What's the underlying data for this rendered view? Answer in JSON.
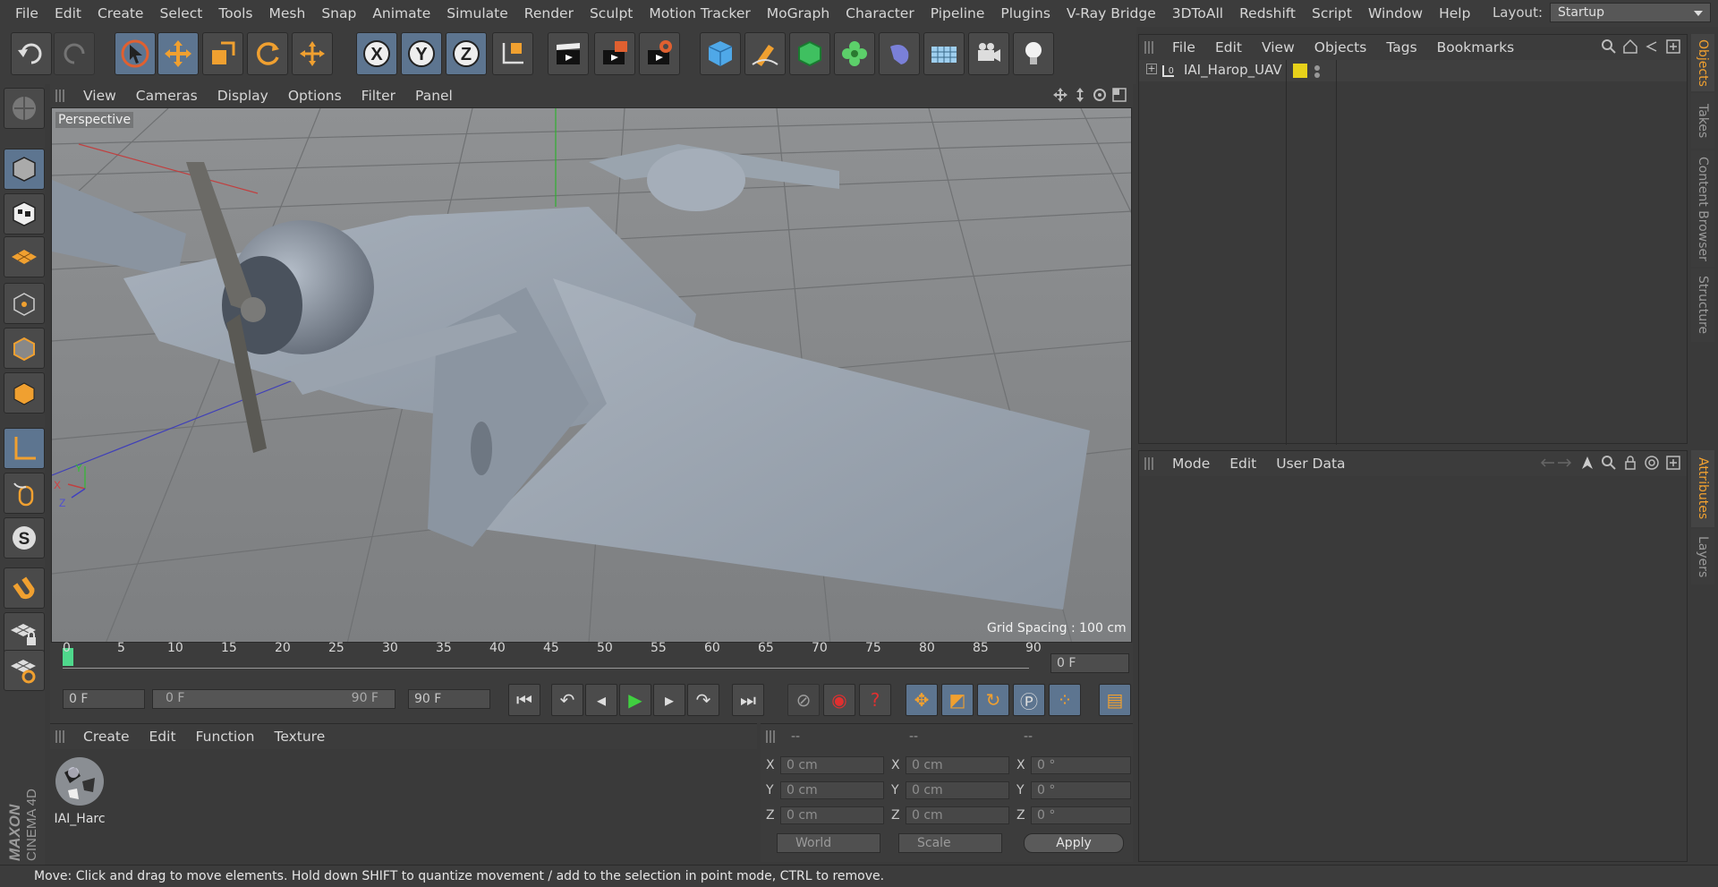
{
  "menubar": {
    "items": [
      "File",
      "Edit",
      "Create",
      "Select",
      "Tools",
      "Mesh",
      "Snap",
      "Animate",
      "Simulate",
      "Render",
      "Sculpt",
      "Motion Tracker",
      "MoGraph",
      "Character",
      "Pipeline",
      "Plugins",
      "V-Ray Bridge",
      "3DToAll",
      "Redshift",
      "Script",
      "Window",
      "Help"
    ],
    "layout_label": "Layout:",
    "layout_value": "Startup"
  },
  "viewport": {
    "menu": [
      "View",
      "Cameras",
      "Display",
      "Options",
      "Filter",
      "Panel"
    ],
    "camera_label": "Perspective",
    "grid_spacing": "Grid Spacing : 100 cm",
    "axis_x": "X",
    "axis_y": "Y",
    "axis_z": "Z"
  },
  "timeline": {
    "ticks": [
      "0",
      "5",
      "10",
      "15",
      "20",
      "25",
      "30",
      "35",
      "40",
      "45",
      "50",
      "55",
      "60",
      "65",
      "70",
      "75",
      "80",
      "85",
      "90"
    ],
    "current_frame": "0 F"
  },
  "transport": {
    "start_field": "0 F",
    "range_start": "0 F",
    "range_end": "90 F",
    "end_field": "90 F"
  },
  "materials": {
    "menu": [
      "Create",
      "Edit",
      "Function",
      "Texture"
    ],
    "items": [
      {
        "name": "IAI_Harc"
      }
    ]
  },
  "coords": {
    "headers": [
      "--",
      "--",
      "--"
    ],
    "rows": [
      {
        "label": "X",
        "pos": "0 cm",
        "label2": "X",
        "size": "0 cm",
        "label3": "X",
        "rot": "0 °"
      },
      {
        "label": "Y",
        "pos": "0 cm",
        "label2": "Y",
        "size": "0 cm",
        "label3": "Y",
        "rot": "0 °"
      },
      {
        "label": "Z",
        "pos": "0 cm",
        "label2": "Z",
        "size": "0 cm",
        "label3": "Z",
        "rot": "0 °"
      }
    ],
    "space": "World",
    "mode": "Scale",
    "apply": "Apply"
  },
  "objects": {
    "menu": [
      "File",
      "Edit",
      "View",
      "Objects",
      "Tags",
      "Bookmarks"
    ],
    "items": [
      {
        "name": "IAI_Harop_UAV",
        "tag_color": "#e8d21a"
      }
    ]
  },
  "attributes": {
    "menu": [
      "Mode",
      "Edit",
      "User Data"
    ]
  },
  "side_tabs": {
    "top": [
      "Objects",
      "Takes",
      "Content Browser",
      "Structure"
    ],
    "bottom": [
      "Attributes",
      "Layers"
    ]
  },
  "brand": {
    "maker": "MAXON",
    "product": "CINEMA 4D"
  },
  "status": "Move: Click and drag to move elements. Hold down SHIFT to quantize movement / add to the selection in point mode, CTRL to remove.",
  "colors": {
    "accent": "#f0a030",
    "active_button": "#5d7590",
    "tag_yellow": "#e8d21a"
  }
}
